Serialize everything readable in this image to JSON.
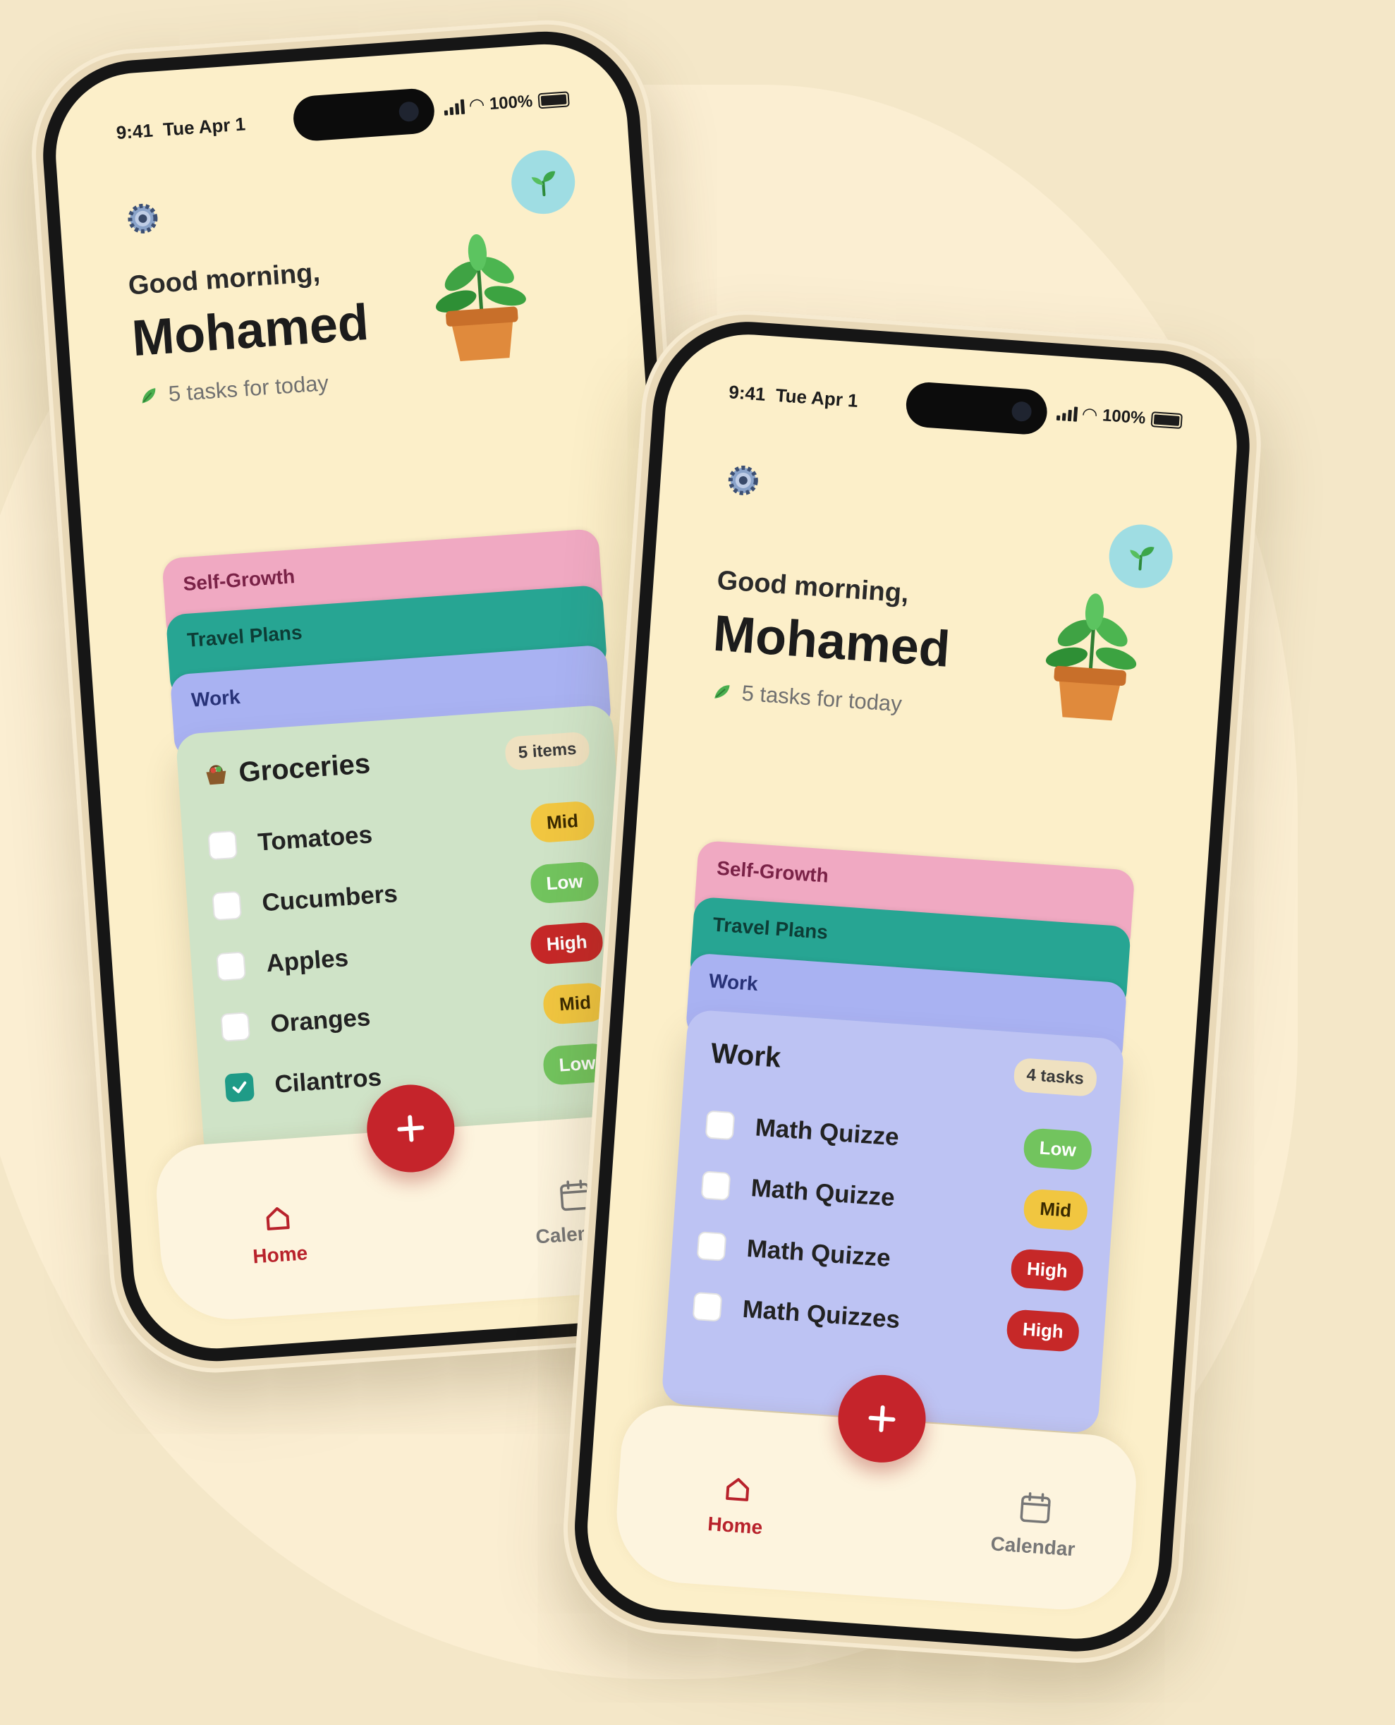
{
  "status": {
    "time": "9:41",
    "date": "Tue Apr 1",
    "battery": "100%"
  },
  "greeting": "Good morning,",
  "user_name": "Mohamed",
  "tasks_summary": "5 tasks for today",
  "categories": [
    "Self-Growth",
    "Travel Plans",
    "Work"
  ],
  "colors": {
    "self_growth": "#f0a9c2",
    "travel_plans": "#27a593",
    "work": "#a9b2f2",
    "groceries_card": "#cfe3c7",
    "work_card": "#bdc3f3",
    "accent_red": "#c5242b",
    "background": "#fcefc9"
  },
  "groceries": {
    "title": "Groceries",
    "count": "5 items",
    "items": [
      {
        "label": "Tomatoes",
        "priority": "Mid",
        "checked": false
      },
      {
        "label": "Cucumbers",
        "priority": "Low",
        "checked": false
      },
      {
        "label": "Apples",
        "priority": "High",
        "checked": false
      },
      {
        "label": "Oranges",
        "priority": "Mid",
        "checked": false
      },
      {
        "label": "Cilantros",
        "priority": "Low",
        "checked": true
      }
    ]
  },
  "work": {
    "title": "Work",
    "count": "4 tasks",
    "items": [
      {
        "label": "Math Quizze",
        "priority": "Low",
        "checked": false
      },
      {
        "label": "Math Quizze",
        "priority": "Mid",
        "checked": false
      },
      {
        "label": "Math Quizze",
        "priority": "High",
        "checked": false
      },
      {
        "label": "Math Quizzes",
        "priority": "High",
        "checked": false
      }
    ]
  },
  "nav": {
    "home": "Home",
    "calendar": "Calendar",
    "add": "+"
  },
  "icons": [
    "gear-icon",
    "sprout-icon",
    "plant-icon",
    "leaf-icon",
    "basket-icon",
    "home-icon",
    "calendar-icon",
    "plus-icon",
    "check-icon"
  ]
}
